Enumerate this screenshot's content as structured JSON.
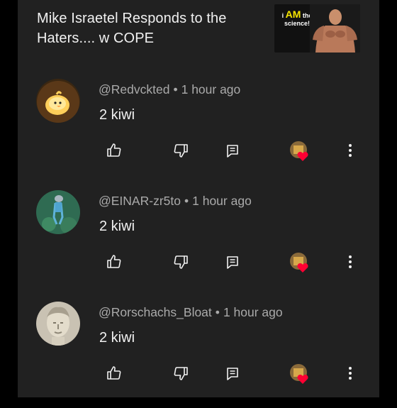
{
  "video": {
    "title": "Mike Israetel Responds to the Haters.... w COPE",
    "thumbnail_caption_prefix": "i",
    "thumbnail_caption_highlight": "AM",
    "thumbnail_caption_rest": "the science!"
  },
  "comments": [
    {
      "author": "@Redvckted",
      "time": "1 hour ago",
      "separator": "•",
      "text": "2 kiwi",
      "avatar_icon": "duck-avatar-icon"
    },
    {
      "author": "@EINAR-zr5to",
      "time": "1 hour ago",
      "separator": "•",
      "text": "2 kiwi",
      "avatar_icon": "figure-avatar-icon"
    },
    {
      "author": "@Rorschachs_Bloat",
      "time": "1 hour ago",
      "separator": "•",
      "text": "2 kiwi",
      "avatar_icon": "statue-avatar-icon"
    }
  ],
  "actions": {
    "like_icon": "thumbs-up-icon",
    "dislike_icon": "thumbs-down-icon",
    "reply_icon": "reply-icon",
    "creator_heart_icon": "creator-heart-icon",
    "more_icon": "more-vertical-icon"
  },
  "colors": {
    "background": "#000000",
    "panel": "#212121",
    "text": "#f1f1f1",
    "meta": "#aaaaaa",
    "heart": "#ff0033",
    "thumb_highlight": "#f7e600"
  }
}
